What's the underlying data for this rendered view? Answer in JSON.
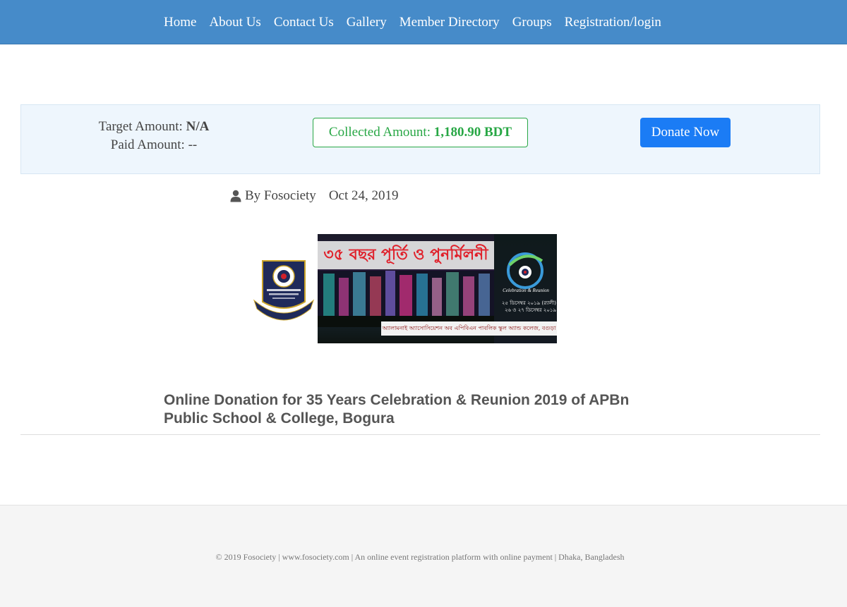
{
  "nav": {
    "items": [
      "Home",
      "About Us",
      "Contact Us",
      "Gallery",
      "Member Directory",
      "Groups",
      "Registration/login"
    ]
  },
  "donation": {
    "target_label": "Target Amount:",
    "target_value": "N/A",
    "paid_label": "Paid Amount:",
    "paid_value": "--",
    "collected_label": "Collected Amount:",
    "collected_value": "1,180.90 BDT",
    "donate_button": "Donate Now"
  },
  "meta": {
    "author": "By Fosociety",
    "date": "Oct 24, 2019",
    "icon": "user-icon"
  },
  "banner": {
    "title_bn": "৩৫ বছর পূর্তি ও পুনর্মিলনী",
    "years_number": "35",
    "years_label": "Years",
    "celebration": "Celebration & Reunion",
    "date_line_1": "২৫ ডিসেম্বর ২০১৯ (র‍্যালী)",
    "date_line_2": "২৬ ও ২৭ ডিসেম্বর ২০১৯",
    "bottom_text": "অ্যালামনাই অ্যাসোসিয়েশন অব এপিবিএন পাবলিক স্কুল অ্যান্ড কলেজ, বগুড়া"
  },
  "post": {
    "title": "Online Donation for 35 Years Celebration & Reunion 2019 of APBn Public School & College, Bogura"
  },
  "footer": {
    "text": "© 2019 Fosociety | www.fosociety.com | An online event registration platform with online payment | Dhaka, Bangladesh"
  },
  "colors": {
    "nav_bg": "#468bc9",
    "panel_bg": "#eef6fd",
    "success": "#28a745",
    "primary": "#1b7cf5"
  }
}
